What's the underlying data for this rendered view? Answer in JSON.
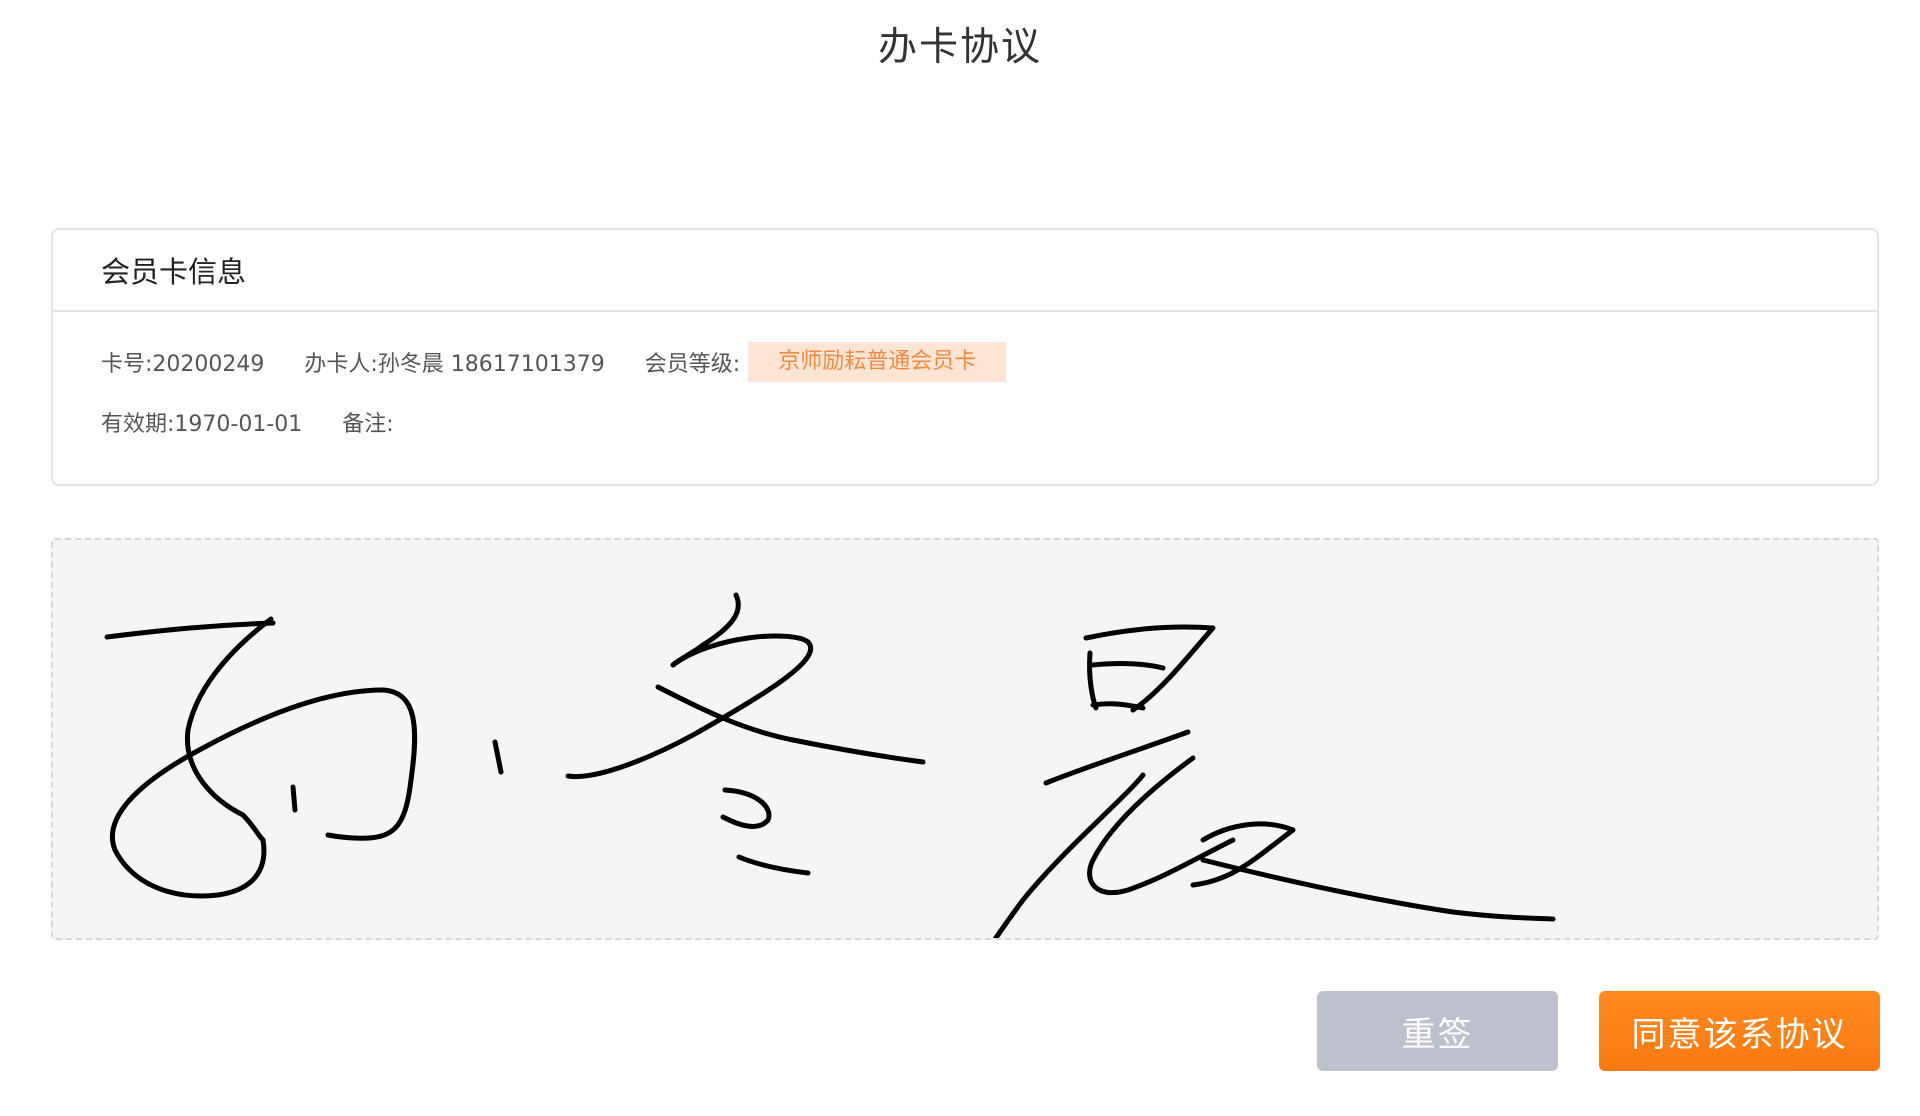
{
  "header": {
    "title": "办卡协议"
  },
  "member_card": {
    "section_title": "会员卡信息",
    "card_number": "卡号:20200249",
    "applicant": "办卡人:孙冬晨 18617101379",
    "level_label": "会员等级:",
    "level_value": "京师励耘普通会员卡",
    "expiry": "有效期:1970-01-01",
    "remark": "备注:"
  },
  "signature": {
    "signed_name": "孙冬晨"
  },
  "actions": {
    "resign_label": "重签",
    "agree_label": "同意该系协议"
  },
  "colors": {
    "accent": "#f97a12",
    "badge_bg": "#fde5d6",
    "badge_text": "#f28a3d",
    "resign_bg": "#bdc1cd",
    "pad_bg": "#f7f4f6"
  }
}
